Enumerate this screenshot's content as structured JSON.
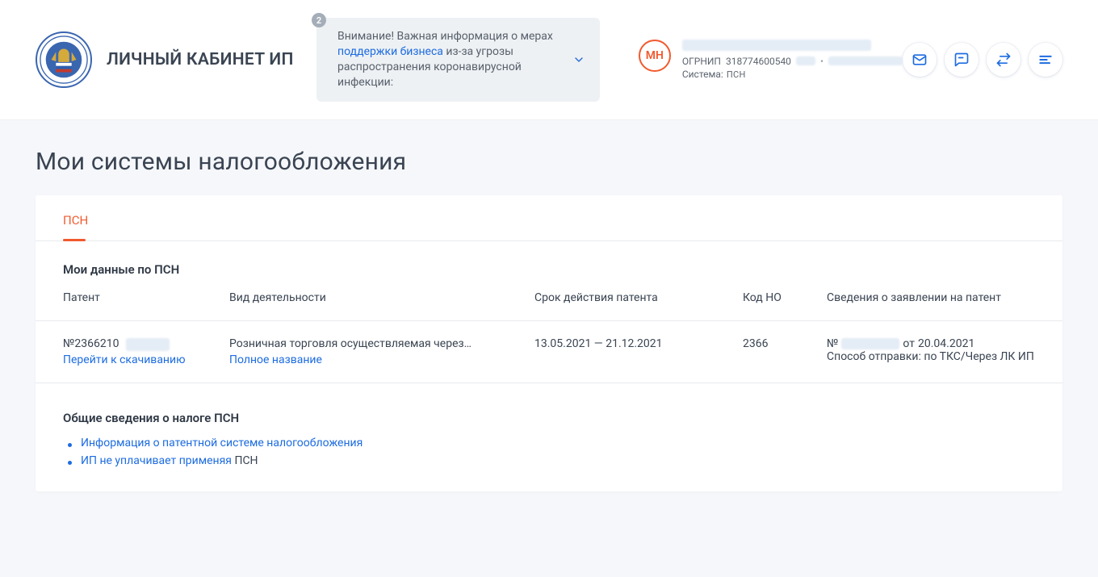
{
  "header": {
    "title": "ЛИЧНЫЙ КАБИНЕТ ИП",
    "notice": {
      "badge": "2",
      "prefix": "Внимание! Важная информация о мерах ",
      "link": "поддержки бизнеса",
      "suffix": " из-за угрозы распространения коронавирусной инфекции:"
    },
    "user": {
      "initials": "МН",
      "ogrnip_label": "ОГРНИП",
      "ogrnip": "318774600540",
      "system_label": "Система:",
      "system_value": "ПСН"
    }
  },
  "page": {
    "title": "Мои системы налогообложения"
  },
  "tabs": {
    "active": "ПСН"
  },
  "section": {
    "title_prefix": "Мои данные по ",
    "title_em": "ПСН",
    "columns": {
      "patent": "Патент",
      "activity": "Вид деятельности",
      "validity": "Срок действия патента",
      "no_code": "Код НО",
      "application": "Сведения о заявлении на патент"
    },
    "row": {
      "patent_number": "№2366210",
      "download_link": "Перейти к скачиванию",
      "activity_short": "Розничная торговля осуществляемая через…",
      "full_name_link": "Полное название",
      "validity": "13.05.2021 — 21.12.2021",
      "no_code": "2366",
      "app_prefix": "№",
      "app_date_prefix": " от ",
      "app_date": "20.04.2021",
      "app_method_label": "Способ отправки: ",
      "app_method_value": "по ТКС/Через ЛК ИП"
    }
  },
  "general": {
    "title_prefix": "Общие сведения о налоге ",
    "title_em": "ПСН",
    "items": {
      "info_link": "Информация о патентной системе налогообложения",
      "ip_not_pay_prefix": "ИП не уплачивает применяя ",
      "ip_not_pay_link": "ПСН"
    }
  }
}
